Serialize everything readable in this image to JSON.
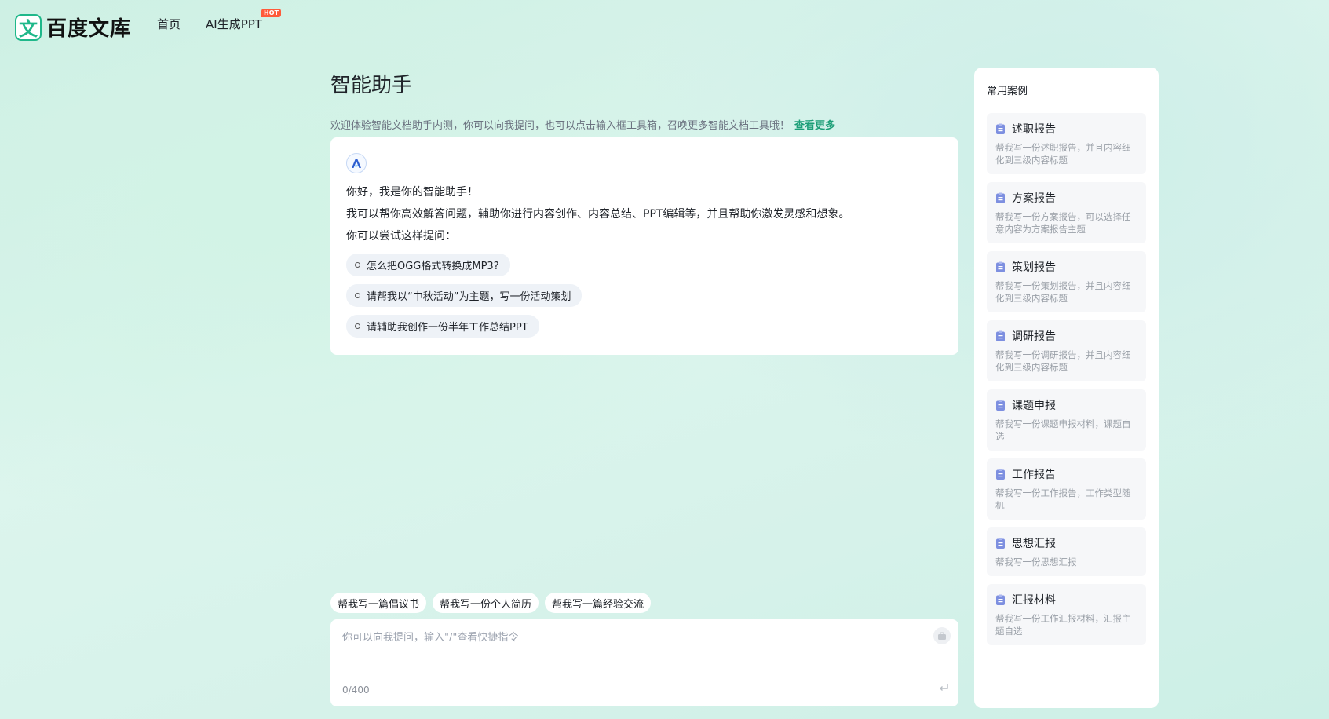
{
  "header": {
    "logo_char": "文",
    "logo_text": "百度文库",
    "nav": [
      {
        "label": "首页"
      },
      {
        "label": "AI生成PPT",
        "badge": "HOT"
      }
    ]
  },
  "main": {
    "title": "智能助手",
    "subtitle": "欢迎体验智能文档助手内测，你可以向我提问，也可以点击输入框工具箱，召唤更多智能文档工具哦！",
    "more_link": "查看更多",
    "chat": {
      "greeting": "你好，我是你的智能助手！",
      "intro": "我可以帮你高效解答问题，辅助你进行内容创作、内容总结、PPT编辑等，并且帮助你激发灵感和想象。",
      "prompt": "你可以尝试这样提问：",
      "suggestions": [
        "怎么把OGG格式转换成MP3?",
        "请帮我以“中秋活动”为主题，写一份活动策划",
        "请辅助我创作一份半年工作总结PPT"
      ]
    },
    "quick_prompts": [
      "帮我写一篇倡议书",
      "帮我写一份个人简历",
      "帮我写一篇经验交流"
    ],
    "input": {
      "placeholder": "你可以向我提问，输入\"/\"查看快捷指令",
      "value": "",
      "counter": "0/400"
    }
  },
  "sidebar": {
    "title": "常用案例",
    "cases": [
      {
        "title": "述职报告",
        "desc": "帮我写一份述职报告，并且内容细化到三级内容标题"
      },
      {
        "title": "方案报告",
        "desc": "帮我写一份方案报告，可以选择任意内容为方案报告主题"
      },
      {
        "title": "策划报告",
        "desc": "帮我写一份策划报告，并且内容细化到三级内容标题"
      },
      {
        "title": "调研报告",
        "desc": "帮我写一份调研报告，并且内容细化到三级内容标题"
      },
      {
        "title": "课题申报",
        "desc": "帮我写一份课题申报材料，课题自选"
      },
      {
        "title": "工作报告",
        "desc": "帮我写一份工作报告，工作类型随机"
      },
      {
        "title": "思想汇报",
        "desc": "帮我写一份思想汇报"
      },
      {
        "title": "汇报材料",
        "desc": "帮我写一份工作汇报材料，汇报主题自选"
      }
    ]
  },
  "colors": {
    "accent": "#1fb88a",
    "link": "#1c9e77",
    "hot_badge": "#ff5b3a",
    "case_icon": "#7d8fe0"
  }
}
